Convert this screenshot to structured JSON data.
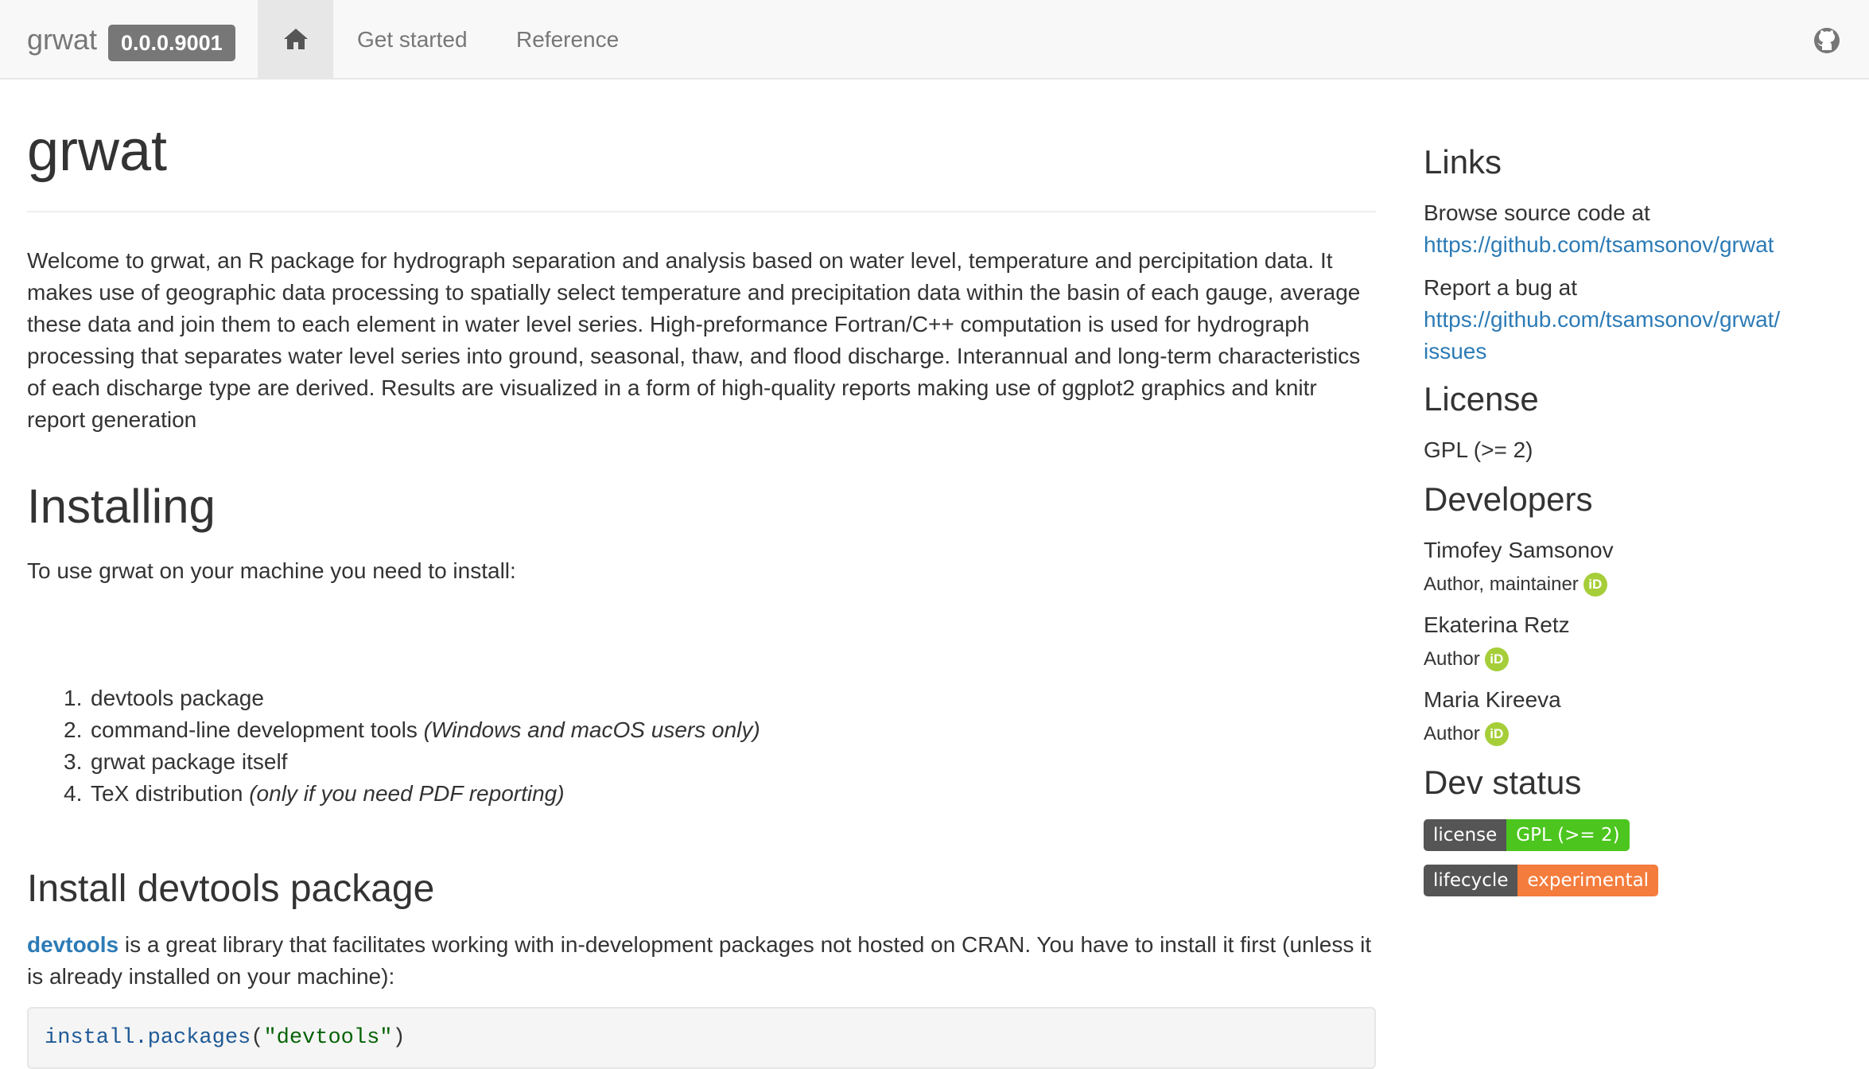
{
  "navbar": {
    "brand": "grwat",
    "version": "0.0.0.9001",
    "links": [
      "Get started",
      "Reference"
    ],
    "icons": [
      "home-icon",
      "github-icon"
    ]
  },
  "main": {
    "title": "grwat",
    "intro": "Welcome to grwat, an R package for hydrograph separation and analysis based on water level, temperature and percipitation data. It makes use of geographic data processing to spatially select temperature and precipitation data within the basin of each gauge, average these data and join them to each element in water level series. High-preformance Fortran/C++ computation is used for hydrograph processing that separates water level series into ground, seasonal, thaw, and flood discharge. Interannual and long-term characteristics of each discharge type are derived. Results are visualized in a form of high-quality reports making use of ggplot2 graphics and knitr report generation",
    "installing_heading": "Installing",
    "installing_lead": "To use grwat on your machine you need to install:",
    "steps": [
      {
        "num": "1.",
        "text": "devtools package",
        "note": ""
      },
      {
        "num": "2.",
        "text": "command-line development tools ",
        "note": "(Windows and macOS users only)"
      },
      {
        "num": "3.",
        "text": "grwat package itself",
        "note": ""
      },
      {
        "num": "4.",
        "text": "TeX distribution ",
        "note": "(only if you need PDF reporting)"
      }
    ],
    "devtools_heading": "Install devtools package",
    "devtools_link": "devtools",
    "devtools_text": " is a great library that facilitates working with in-development packages not hosted on CRAN. You have to install it first (unless it is already installed on your machine):",
    "code": {
      "fn": "install.packages",
      "open": "(",
      "arg": "\"devtools\"",
      "close": ")"
    }
  },
  "sidebar": {
    "links_heading": "Links",
    "browse_label": "Browse source code at",
    "browse_url": "https://github.com/tsamsonov/grwat",
    "bug_label": "Report a bug at",
    "bug_url_line1": "https://github.com/tsamsonov/grwat/",
    "bug_url_line2": "issues",
    "license_heading": "License",
    "license": "GPL (>= 2)",
    "developers_heading": "Developers",
    "developers": [
      {
        "name": "Timofey Samsonov",
        "role": "Author, maintainer"
      },
      {
        "name": "Ekaterina Retz",
        "role": "Author"
      },
      {
        "name": "Maria Kireeva",
        "role": "Author"
      }
    ],
    "orcid_label": "iD",
    "devstatus_heading": "Dev status",
    "badges": [
      {
        "left": "license",
        "right": "GPL (>= 2)",
        "color": "#4cc61e"
      },
      {
        "left": "lifecycle",
        "right": "experimental",
        "color": "#f47c3c"
      }
    ]
  },
  "colors": {
    "link": "#2c7bb6",
    "navbar_bg": "#f8f8f8",
    "orcid": "#a6ce39"
  }
}
